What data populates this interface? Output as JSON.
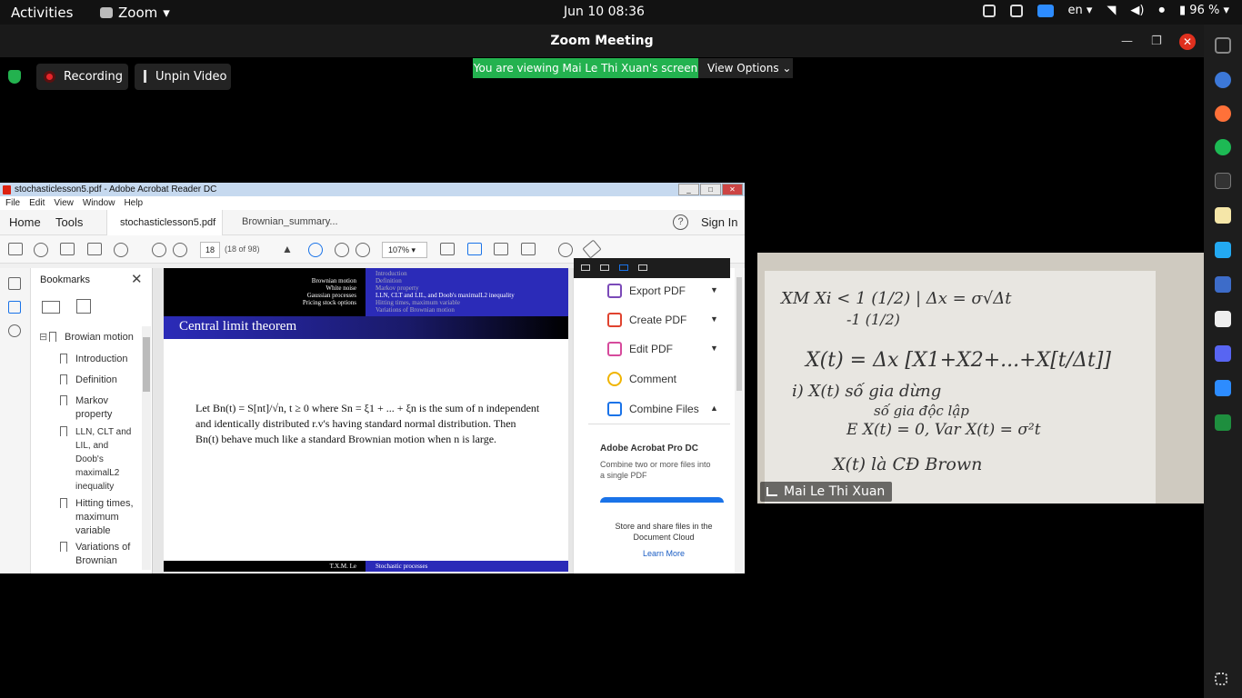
{
  "topbar": {
    "activities": "Activities",
    "app_name": "Zoom",
    "clock": "Jun 10  08:36",
    "lang": "en",
    "battery": "96 %"
  },
  "zoom": {
    "title": "Zoom Meeting",
    "recording": "Recording",
    "unpin": "Unpin Video",
    "viewing": "You are viewing Mai Le Thi Xuan's screen",
    "view_options": "View Options"
  },
  "acrobat": {
    "title": "stochasticlesson5.pdf - Adobe Acrobat Reader DC",
    "menu": [
      "File",
      "Edit",
      "View",
      "Window",
      "Help"
    ],
    "home": "Home",
    "tools": "Tools",
    "tab_active": "stochasticlesson5.pdf",
    "tab_close": "×",
    "tab_other": "Brownian_summary...",
    "help": "?",
    "sign_in": "Sign In",
    "page_num": "18",
    "page_of": "(18 of 98)",
    "zoom": "107%",
    "bookmarks_title": "Bookmarks",
    "bookmarks": {
      "root": "Browian motion",
      "items": [
        "Introduction",
        "Definition",
        "Markov property",
        "LLN, CLT and LIL, and Doob's maximalL2 inequality",
        "Hitting times, maximum variable",
        "Variations of Brownian"
      ]
    },
    "slide": {
      "left_nav": [
        "Brownian motion",
        "White noise",
        "Gaussian processes",
        "Pricing stock options"
      ],
      "right_nav": [
        "Introduction",
        "Definition",
        "Markov property",
        "LLN, CLT and LIL, and Doob's maximalL2 inequality",
        "Hitting times, maximum variable",
        "Variations of Brownian motion"
      ],
      "heading": "Central limit theorem",
      "body": "Let Bn(t) = S[nt]/√n, t ≥ 0 where Sn = ξ1 + ... + ξn is the sum of n independent and identically distributed r.v's having standard normal distribution. Then Bn(t) behave much like a standard Brownian motion when n is large.",
      "footer_left": "T.X.M. Le",
      "footer_right": "Stochastic processes"
    },
    "right_pane": {
      "items": [
        {
          "label": "Export PDF",
          "color": "#7b4ab8"
        },
        {
          "label": "Create PDF",
          "color": "#e0432f"
        },
        {
          "label": "Edit PDF",
          "color": "#d64a9c"
        },
        {
          "label": "Comment",
          "color": "#f0b400"
        },
        {
          "label": "Combine Files",
          "color": "#1a73e8"
        }
      ],
      "promo_title": "Adobe Acrobat Pro DC",
      "promo_desc": "Combine two or more files into a single PDF",
      "store": "Store and share files in the Document Cloud",
      "learn": "Learn More"
    }
  },
  "video": {
    "name": "Mai Le Thi Xuan",
    "board": [
      "XM   Xi < 1  (1/2) | Δx = σ√Δt",
      "        -1  (1/2)",
      "X(t) = Δx [X1+X2+...+X[t/Δt]]",
      "i) X(t)  số gia dừng",
      "         số gia độc lập",
      "E X(t) = 0, Var X(t) = σ²t",
      "X(t) là CĐ Brown"
    ]
  }
}
